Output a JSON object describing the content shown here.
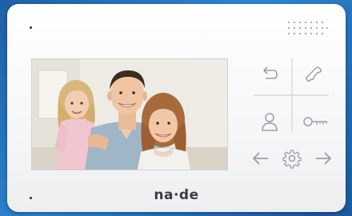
{
  "device": {
    "brand": "na·de",
    "screen": {
      "content": "family-photo"
    }
  },
  "keypad": {
    "buttons": [
      {
        "name": "back-button",
        "icon": "return-arrow-icon"
      },
      {
        "name": "call-button",
        "icon": "phone-handset-icon"
      },
      {
        "name": "user-button",
        "icon": "user-icon"
      },
      {
        "name": "door-open-button",
        "icon": "key-icon"
      },
      {
        "name": "previous-button",
        "icon": "arrow-left-icon"
      },
      {
        "name": "settings-button",
        "icon": "gear-icon"
      },
      {
        "name": "next-button",
        "icon": "arrow-right-icon"
      }
    ]
  },
  "colors": {
    "background": "#2c86cf",
    "panel": "#f7f7f8",
    "icon": "#9aa0a6",
    "brand_text": "#3a3d42"
  }
}
